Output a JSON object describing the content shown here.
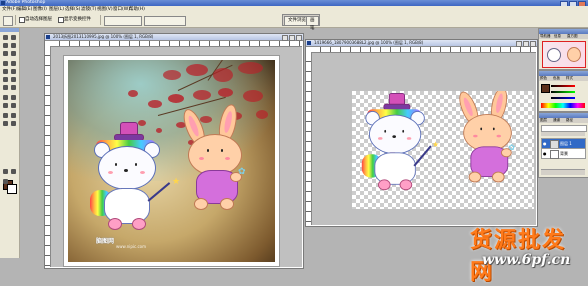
{
  "app": {
    "title": "Adobe Photoshop"
  },
  "menu": [
    "文件(F)",
    "编辑(E)",
    "图像(I)",
    "图层(L)",
    "选择(S)",
    "滤镜(T)",
    "视图(V)",
    "窗口(W)",
    "帮助(H)"
  ],
  "options": {
    "auto_select_label": "自动选择图层",
    "show_transform_label": "显示变换控件"
  },
  "palette_well": {
    "tabs": [
      "文件浏览器",
      "画笔"
    ]
  },
  "documents": [
    {
      "title": "2013拆图2013110995.jpg @ 100% (图层 1, RGB/8)"
    },
    {
      "title": "1419666_18079003688L2.jpg @ 100% (图层 1, RGB/8)"
    }
  ],
  "panels": {
    "navigator_tabs": [
      "导航器",
      "信息",
      "直方图"
    ],
    "color_tabs": [
      "颜色",
      "色板",
      "样式"
    ],
    "layers_tabs": [
      "图层",
      "通道",
      "路径"
    ],
    "layers": [
      {
        "name": "图层 1",
        "selected": true
      },
      {
        "name": "背景",
        "selected": false
      }
    ]
  },
  "artwork": {
    "watermark": "脑图网",
    "watermark_sub": "www.nipic.com"
  },
  "brand": {
    "name": "货源批发网",
    "url": "www.6pf.cn"
  },
  "colors": {
    "foreground": "#5a2f1a",
    "background": "#ffffff",
    "title_blue": "#3d66c2"
  }
}
